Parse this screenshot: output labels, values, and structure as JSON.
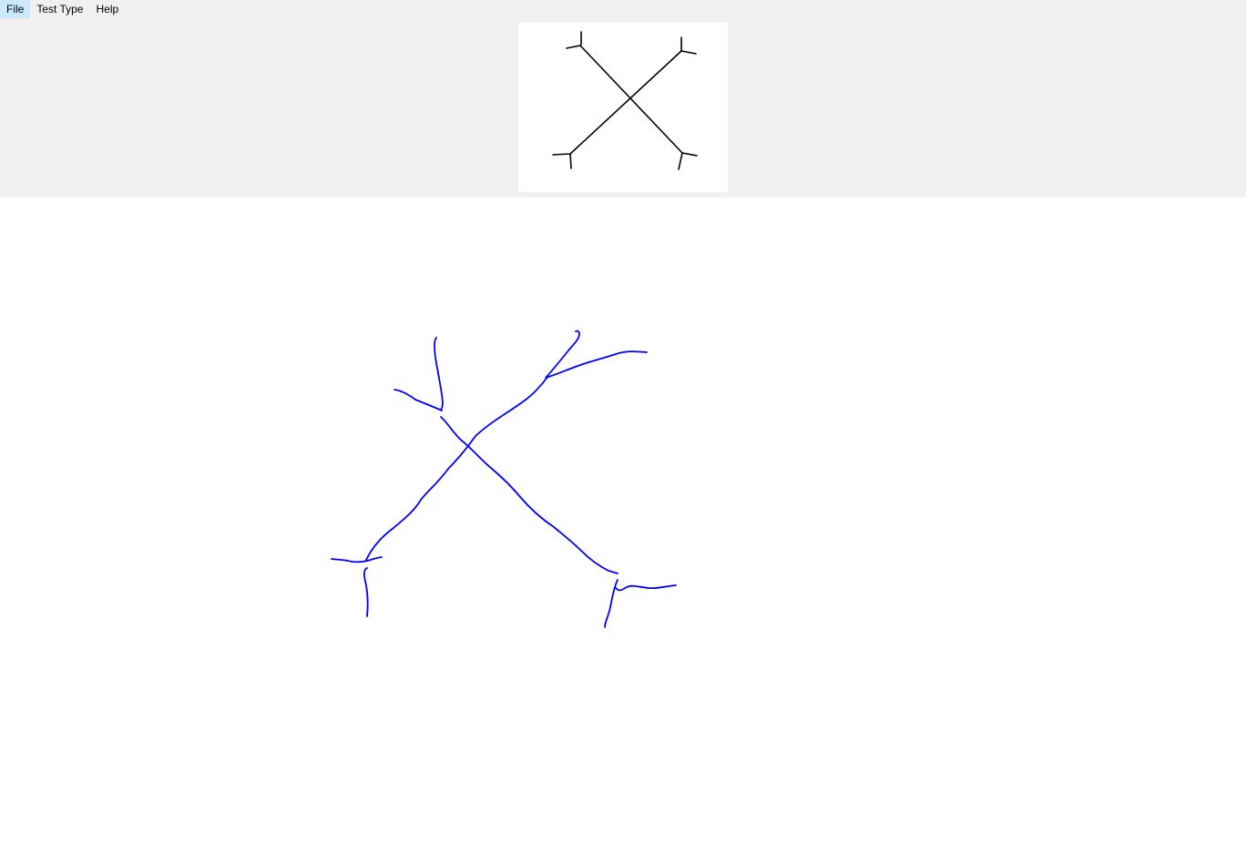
{
  "menubar": {
    "items": [
      {
        "label": "File"
      },
      {
        "label": "Test Type"
      },
      {
        "label": "Help"
      }
    ]
  },
  "reference_image": {
    "stroke_color": "#000000"
  },
  "drawing_canvas": {
    "stroke_color": "#0000ff",
    "background_color": "#ffffff"
  },
  "colors": {
    "toolbar_background": "#f0f0f0",
    "canvas_background": "#ffffff"
  }
}
